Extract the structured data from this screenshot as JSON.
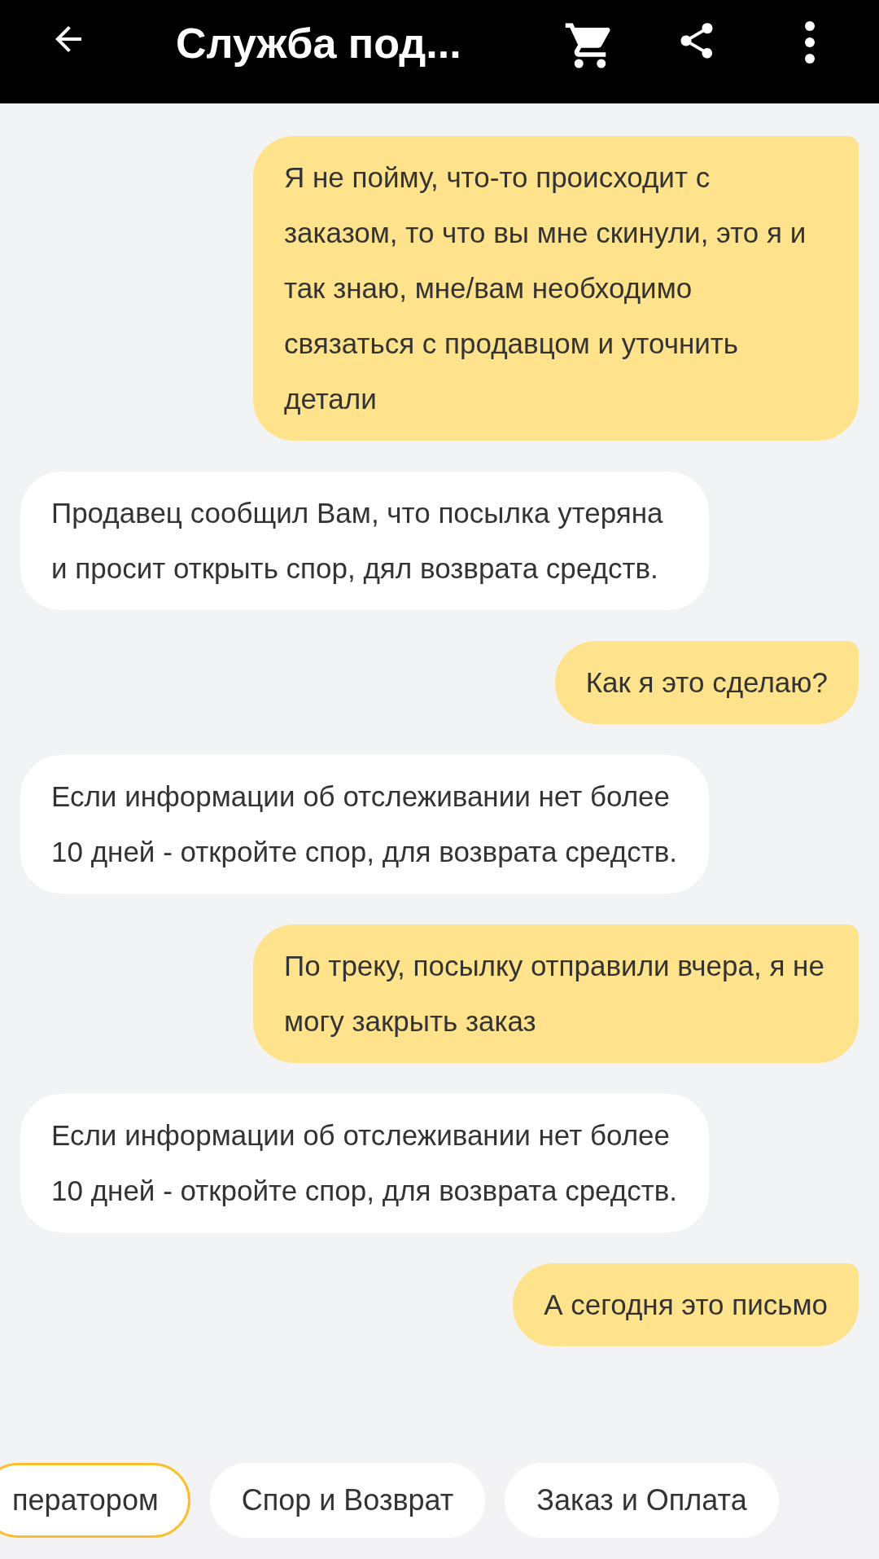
{
  "header": {
    "title": "Служба под..."
  },
  "messages": [
    {
      "kind": "user",
      "text": "Я не пойму, что-то происходит с заказом, то что вы мне скинули, это я и так знаю, мне/вам необходимо связаться с продавцом и уточнить детали"
    },
    {
      "kind": "support",
      "text": "Продавец сообщил Вам, что посылка утеряна и просит открыть спор, дял возврата средств."
    },
    {
      "kind": "user",
      "text": "Как я это сделаю?"
    },
    {
      "kind": "support",
      "text": "Если информации об отслеживании нет более 10 дней - откройте спор, для возврата средств."
    },
    {
      "kind": "user",
      "text": "По треку, посылку отправили вчера, я не могу закрыть заказ"
    },
    {
      "kind": "support",
      "text": "Если информации об отслеживании нет более 10 дней - откройте спор, для возврата средств."
    },
    {
      "kind": "user",
      "text": "А сегодня это письмо"
    }
  ],
  "quick_replies": [
    {
      "label": "ператором",
      "selected": true
    },
    {
      "label": "Спор и Возврат",
      "selected": false
    },
    {
      "label": "Заказ и Оплата",
      "selected": false
    }
  ]
}
